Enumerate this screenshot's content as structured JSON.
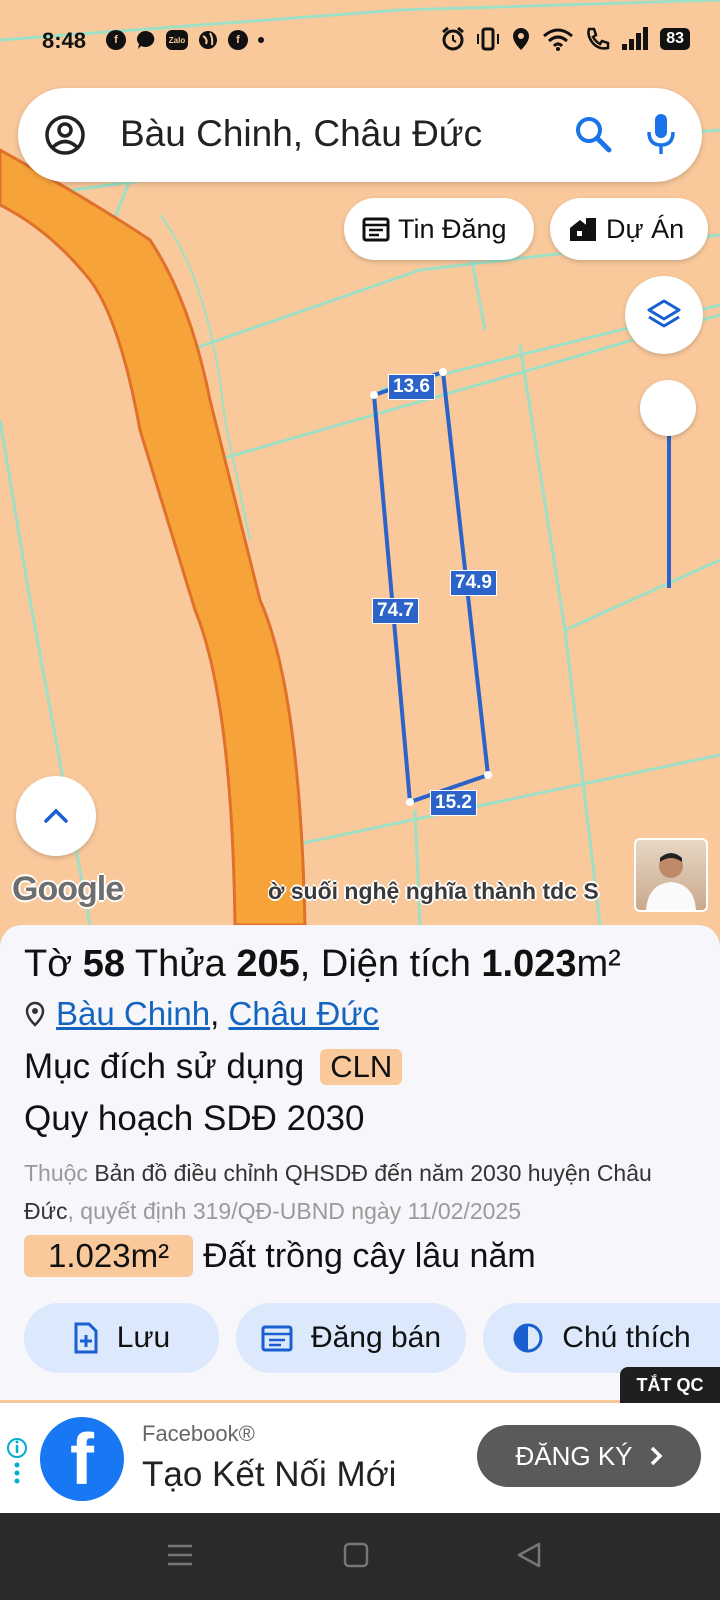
{
  "status_bar": {
    "time": "8:48",
    "battery": "83",
    "left_icons": [
      "facebook-icon",
      "messenger-icon",
      "zalo-icon",
      "globe-icon",
      "facebook-icon",
      "dot-icon"
    ],
    "right_icons": [
      "alarm-icon",
      "vibrate-icon",
      "location-icon",
      "wifi-icon",
      "call-icon",
      "signal-icon"
    ],
    "zalo_label": "Zalo",
    "fb_letter": "f"
  },
  "search": {
    "query": "Bàu Chinh, Châu Đức"
  },
  "chips": {
    "listings": "Tin Đăng",
    "projects": "Dự Án"
  },
  "map": {
    "google_label": "Google",
    "road_label": "ờ suối nghệ nghĩa thành tdc S",
    "dimensions": {
      "top": "13.6",
      "left": "74.7",
      "right": "74.9",
      "bottom": "15.2"
    },
    "parcel_color": "#2b63c8",
    "land_color": "#f9c99c",
    "road_color": "#f6a33a"
  },
  "panel": {
    "sheet_label": "Tờ",
    "sheet_no": "58",
    "parcel_label": "Thửa",
    "parcel_no": "205",
    "area_label": "Diện tích",
    "area_value": "1.023",
    "area_unit": "m²",
    "commune": "Bàu Chinh",
    "district": "Châu Đức",
    "purpose_label": "Mục đích sử dụng",
    "purpose_code": "CLN",
    "plan_title": "Quy hoạch SDĐ 2030",
    "desc_prefix": "Thuộc",
    "desc_map": "Bản đồ điều chỉnh QHSDĐ đến năm 2030 huyện Châu Đức",
    "desc_decision": ", quyết định 319/QĐ-UBND ngày 11/02/2025",
    "area_badge": "1.023m²",
    "land_type": "Đất trồng cây lâu năm"
  },
  "actions": {
    "save": "Lưu",
    "post": "Đăng bán",
    "legend": "Chú thích"
  },
  "ad": {
    "close_label": "TẮT QC",
    "brand": "Facebook®",
    "title": "Tạo Kết Nối Mới",
    "cta": "ĐĂNG KÝ",
    "logo_letter": "f"
  },
  "colors": {
    "accent_blue": "#1565c0",
    "button_bg": "#dce8fb"
  }
}
